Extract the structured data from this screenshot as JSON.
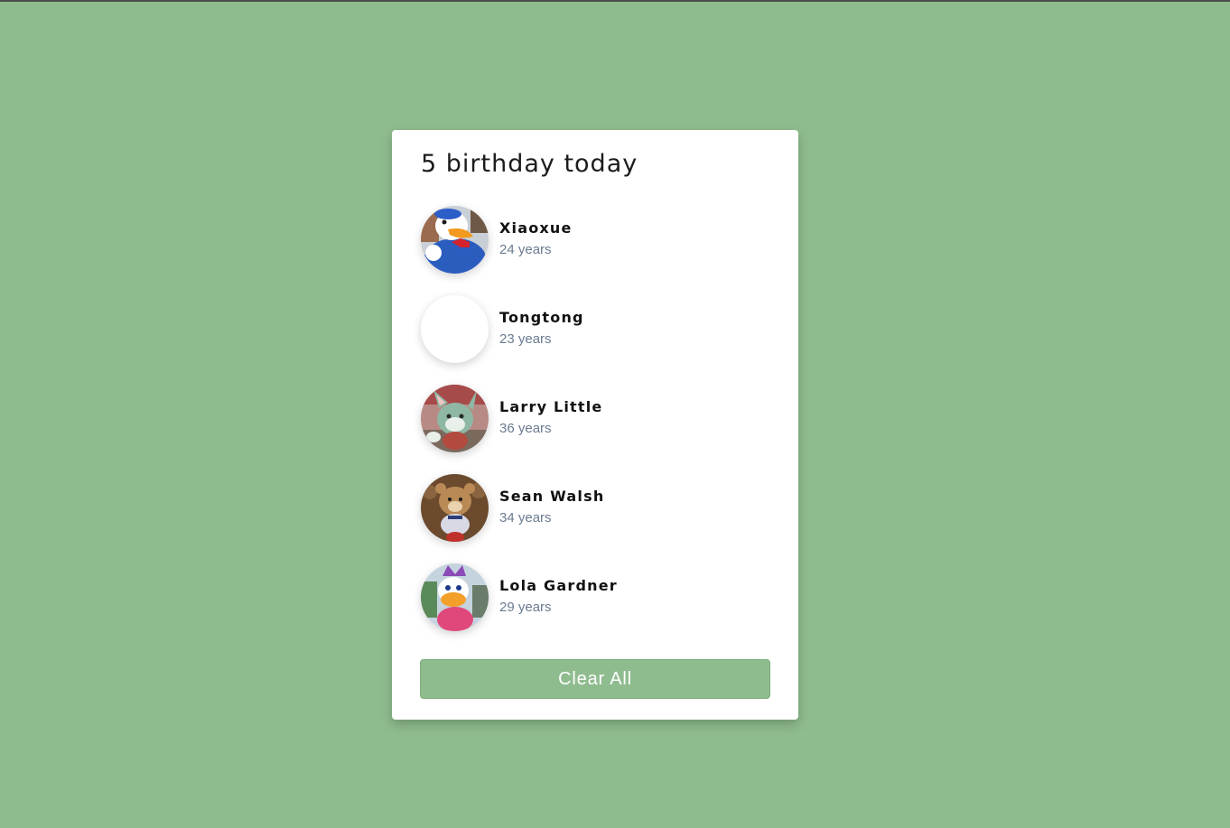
{
  "colors": {
    "background": "#8fbc8f",
    "card": "#ffffff",
    "age_text": "#6b7b91",
    "button": "#8fbc8f"
  },
  "card": {
    "title": "5 birthday today",
    "people": [
      {
        "name": "Xiaoxue",
        "age": "24 years",
        "avatar": "donald-duck-avatar"
      },
      {
        "name": "Tongtong",
        "age": "23 years",
        "avatar": "blank-avatar"
      },
      {
        "name": "Larry Little",
        "age": "36 years",
        "avatar": "gelatoni-cat-avatar"
      },
      {
        "name": "Sean Walsh",
        "age": "34 years",
        "avatar": "duffy-bear-avatar"
      },
      {
        "name": "Lola Gardner",
        "age": "29 years",
        "avatar": "daisy-duck-avatar"
      }
    ],
    "clear_button_label": "Clear All"
  }
}
